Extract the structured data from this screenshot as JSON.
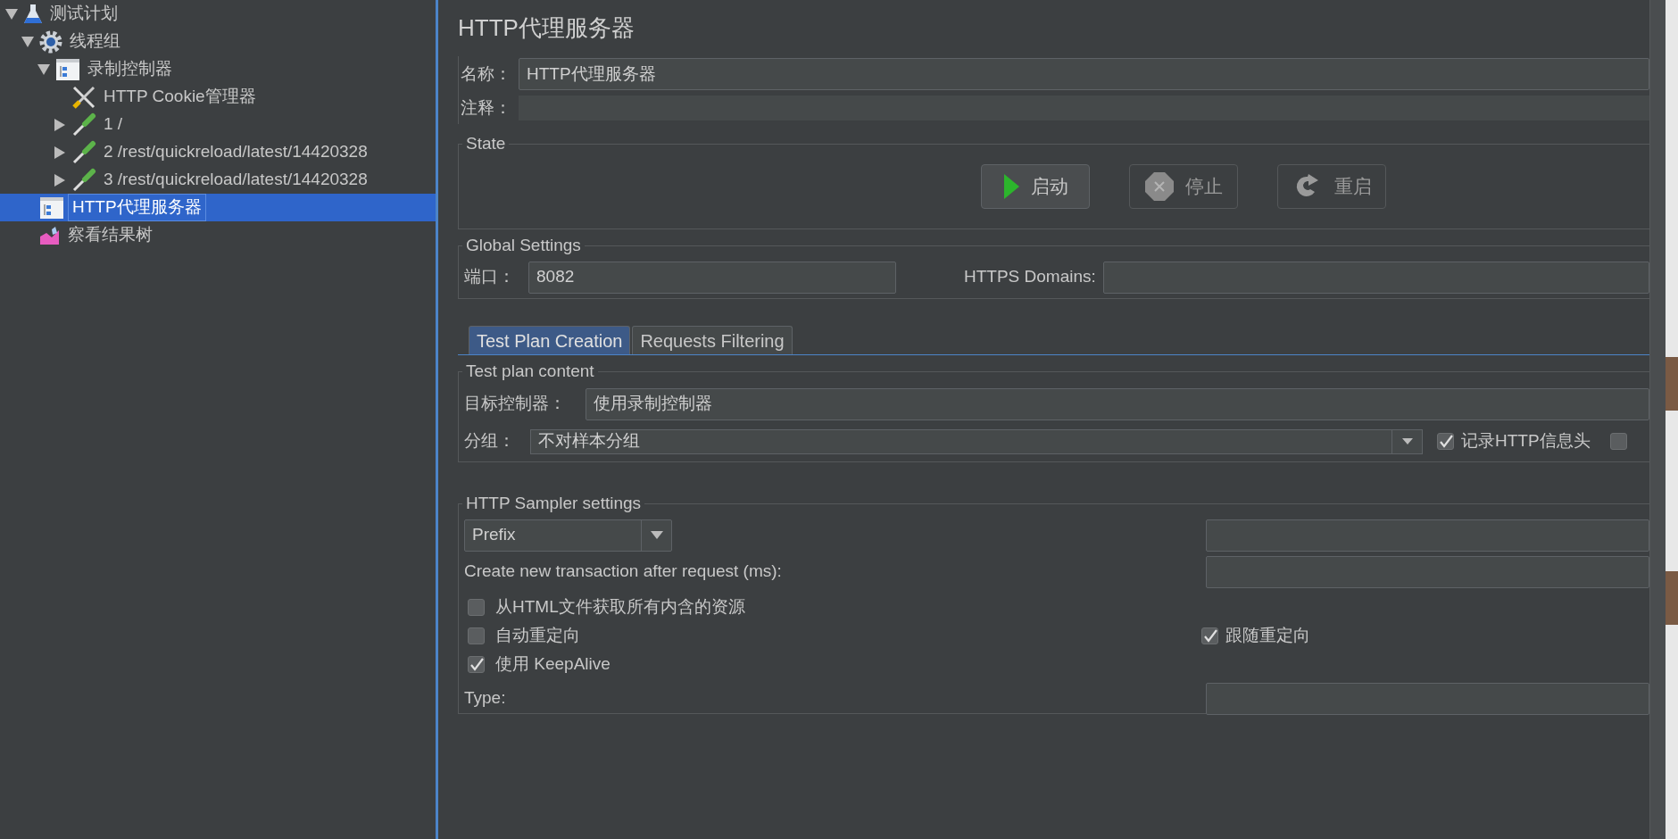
{
  "tree": [
    {
      "label": "测试计划",
      "kind": "test_plan",
      "expanded": true,
      "selected": false,
      "children": [
        {
          "label": "线程组",
          "kind": "thread_group",
          "expanded": true,
          "selected": false,
          "children": [
            {
              "label": "录制控制器",
              "kind": "controller",
              "expanded": true,
              "selected": false,
              "children": [
                {
                  "label": "HTTP Cookie管理器",
                  "kind": "config",
                  "selected": false
                },
                {
                  "label": "1 /",
                  "kind": "sampler",
                  "expanded": false,
                  "selected": false
                },
                {
                  "label": "2 /rest/quickreload/latest/14420328",
                  "kind": "sampler",
                  "expanded": false,
                  "selected": false
                },
                {
                  "label": "3 /rest/quickreload/latest/14420328",
                  "kind": "sampler",
                  "expanded": false,
                  "selected": false
                }
              ]
            }
          ]
        },
        {
          "label": "HTTP代理服务器",
          "kind": "controller",
          "selected": true
        },
        {
          "label": "察看结果树",
          "kind": "listener",
          "selected": false
        }
      ]
    }
  ],
  "panel": {
    "title": "HTTP代理服务器",
    "name": {
      "label": "名称：",
      "value": "HTTP代理服务器"
    },
    "comment": {
      "label": "注释："
    },
    "state": {
      "title": "State",
      "buttons": [
        {
          "label": "启动",
          "kind": "start",
          "disabled": false
        },
        {
          "label": "停止",
          "kind": "stop",
          "disabled": true
        },
        {
          "label": "重启",
          "kind": "restart",
          "disabled": true
        }
      ]
    },
    "global": {
      "title": "Global Settings",
      "port_label": "端口：",
      "port": "8082",
      "https_label": "HTTPS Domains:"
    },
    "tabs": [
      {
        "label": "Test Plan Creation",
        "selected": true
      },
      {
        "label": "Requests Filtering",
        "selected": false
      }
    ],
    "content": {
      "title": "Test plan content",
      "target_label": "目标控制器：",
      "target": "使用录制控制器",
      "group_label": "分组：",
      "group": "不对样本分组",
      "record_headers": {
        "label": "记录HTTP信息头",
        "checked": true
      },
      "extra_checkbox": {
        "checked": false
      }
    },
    "sampler": {
      "title": "HTTP Sampler settings",
      "naming": "Prefix",
      "transaction_label": "Create new transaction after request (ms):",
      "options": [
        {
          "label": "从HTML文件获取所有内含的资源",
          "checked": false
        },
        {
          "label": "自动重定向",
          "checked": false
        },
        {
          "label": "使用 KeepAlive",
          "checked": true
        }
      ],
      "follow_redirects": {
        "label": "跟随重定向",
        "checked": true
      },
      "type_label": "Type:"
    }
  }
}
